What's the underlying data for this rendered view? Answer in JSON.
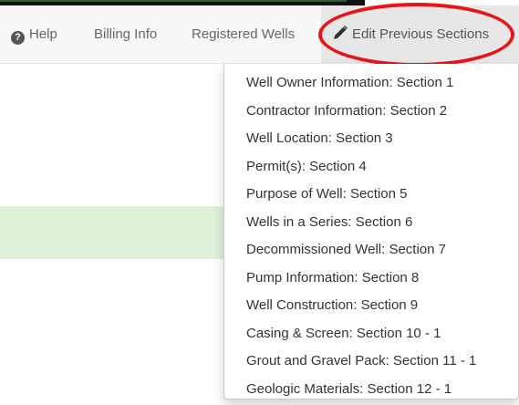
{
  "nav": {
    "help_label": "Help",
    "help_icon": "question-circle-icon",
    "billing_label": "Billing Info",
    "registered_label": "Registered Wells",
    "edit_label": "Edit Previous Sections",
    "edit_icon": "pencil-icon"
  },
  "dropdown": {
    "items": [
      "Well Owner Information: Section 1",
      "Contractor Information: Section 2",
      "Well Location: Section 3",
      "Permit(s): Section 4",
      "Purpose of Well: Section 5",
      "Wells in a Series: Section 6",
      "Decommissioned Well: Section 7",
      "Pump Information: Section 8",
      "Well Construction: Section 9",
      "Casing & Screen: Section 10 - 1",
      "Grout and Gravel Pack: Section 11 - 1",
      "Geologic Materials: Section 12 - 1"
    ]
  },
  "colors": {
    "highlight_oval": "#e8141a",
    "alert_bg": "#dff0d8",
    "navbar_bg": "#f8f8f8"
  }
}
